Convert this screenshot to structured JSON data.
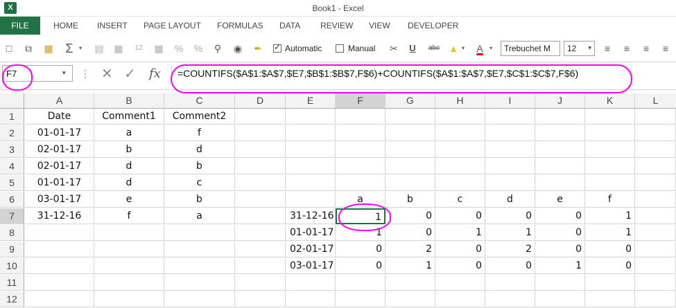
{
  "window": {
    "title": "Book1 - Excel",
    "app_icon": "X"
  },
  "ribbon": {
    "tabs": [
      "FILE",
      "HOME",
      "INSERT",
      "PAGE LAYOUT",
      "FORMULAS",
      "DATA",
      "REVIEW",
      "VIEW",
      "DEVELOPER"
    ]
  },
  "toolbar": {
    "automatic_label": "Automatic",
    "manual_label": "Manual",
    "underline": "U",
    "strike": "abc",
    "font_color_glyph": "A",
    "font_name": "Trebuchet M",
    "font_size": "12"
  },
  "formula_bar": {
    "name_box": "F7",
    "fx": "fx",
    "formula": "=COUNTIFS($A$1:$A$7,$E7,$B$1:$B$7,F$6)+COUNTIFS($A$1:$A$7,$E7,$C$1:$C$7,F$6)"
  },
  "columns": [
    "A",
    "B",
    "C",
    "D",
    "E",
    "F",
    "G",
    "H",
    "I",
    "J",
    "K",
    "L"
  ],
  "rows": [
    "1",
    "2",
    "3",
    "4",
    "5",
    "6",
    "7",
    "8",
    "9",
    "10",
    "11",
    "12"
  ],
  "data_table": {
    "headers": [
      "Date",
      "Comment1",
      "Comment2"
    ],
    "rows": [
      [
        "01-01-17",
        "a",
        "f"
      ],
      [
        "02-01-17",
        "b",
        "d"
      ],
      [
        "02-01-17",
        "d",
        "b"
      ],
      [
        "01-01-17",
        "d",
        "c"
      ],
      [
        "03-01-17",
        "e",
        "b"
      ],
      [
        "31-12-16",
        "f",
        "a"
      ]
    ]
  },
  "matrix": {
    "col_labels": [
      "a",
      "b",
      "c",
      "d",
      "e",
      "f"
    ],
    "row_labels": [
      "31-12-16",
      "01-01-17",
      "02-01-17",
      "03-01-17"
    ],
    "values": [
      [
        "1",
        "0",
        "0",
        "0",
        "0",
        "1"
      ],
      [
        "1",
        "0",
        "1",
        "1",
        "0",
        "1"
      ],
      [
        "0",
        "2",
        "0",
        "2",
        "0",
        "0"
      ],
      [
        "0",
        "1",
        "0",
        "0",
        "1",
        "0"
      ]
    ]
  },
  "colors": {
    "excel_green": "#217346",
    "annotation": "#ff00ff"
  }
}
